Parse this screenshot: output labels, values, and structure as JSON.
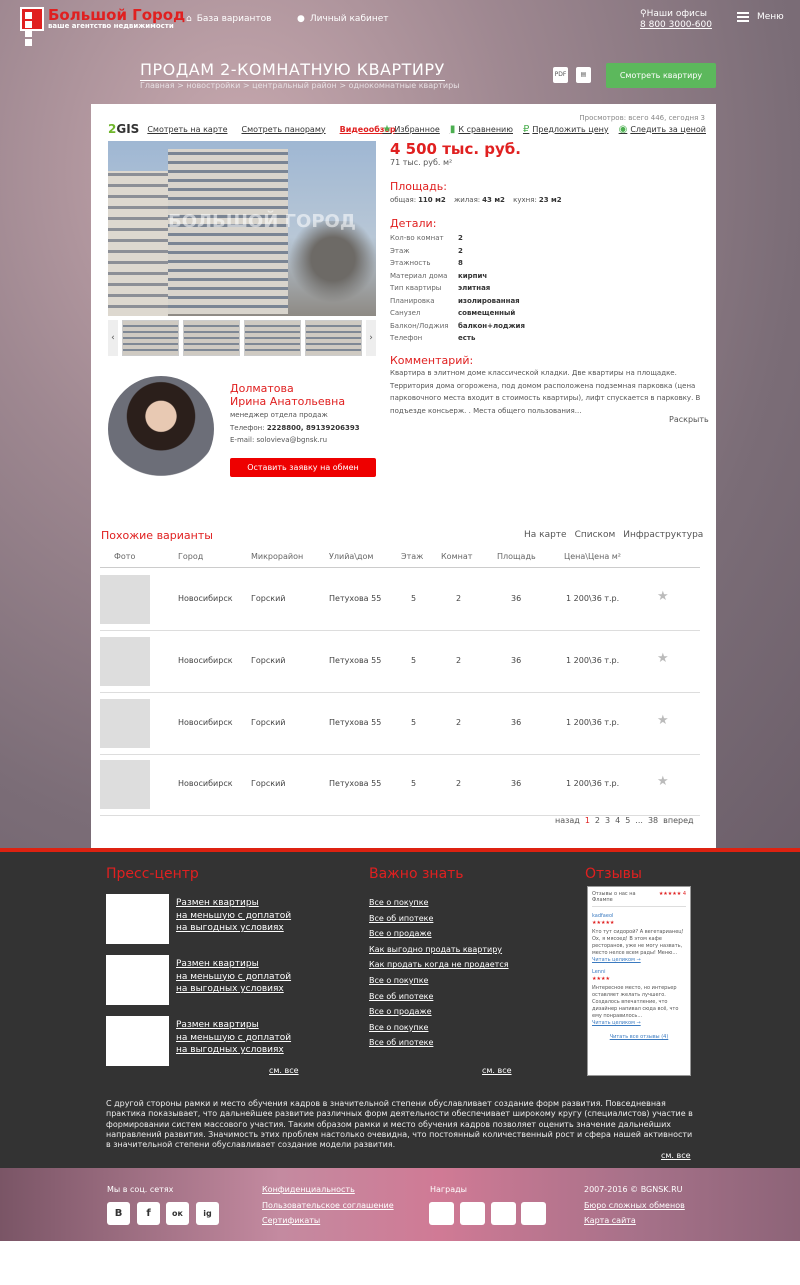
{
  "header": {
    "logo_title": "Большой Город",
    "logo_sub": "ваше агентство недвижимости",
    "nav_base": "База вариантов",
    "nav_cabinet": "Личный кабинет",
    "offices": "Наши офисы",
    "phone": "8 800 3000-600",
    "menu": "Меню"
  },
  "page": {
    "title": "ПРОДАМ 2-КОМНАТНУЮ КВАРТИРУ",
    "breadcrumb": "Главная > новостройки > центральный район > однокомнатные квартиры",
    "view_apartment": "Смотреть квартиру"
  },
  "listing": {
    "views": "Просмотров: всего 446, сегодня 3",
    "gis": "2GIS",
    "on_map": "Смотреть на карте",
    "panorama": "Смотреть панораму",
    "video": "Видеообзор",
    "favorites": "Избранное",
    "compare": "К сравнению",
    "offer_price": "Предложить цену",
    "watch_price": "Следить за ценой",
    "watermark": "БОЛЬШОЙ ГОРОД",
    "price": "4 500 тыс. руб.",
    "price_per_m": "71 тыс. руб. м²",
    "area_title": "Площадь:",
    "area_total_label": "общая:",
    "area_total": "110 м2",
    "area_living_label": "жилая:",
    "area_living": "43 м2",
    "area_kitchen_label": "кухня:",
    "area_kitchen": "23 м2",
    "details_title": "Детали:",
    "details": [
      {
        "k": "Кол-во комнат",
        "v": "2"
      },
      {
        "k": "Этаж",
        "v": "2"
      },
      {
        "k": "Этажность",
        "v": "8"
      },
      {
        "k": "Материал дома",
        "v": "кирпич"
      },
      {
        "k": "Тип квартиры",
        "v": "элитная"
      },
      {
        "k": "Планировка",
        "v": "изолированная"
      },
      {
        "k": "Санузел",
        "v": "совмещенный"
      },
      {
        "k": "Балкон/Лоджия",
        "v": "балкон+лоджия"
      },
      {
        "k": "Телефон",
        "v": "есть"
      }
    ],
    "comment_title": "Комментарий:",
    "comment": "Квартира в элитном доме классической кладки. Две квартиры на площадке. Территория дома огорожена, под домом расположена подземная парковка (цена парковочного места входит в стоимость квартиры), лифт спускается в парковку. В подъезде консьерж. . Места общего пользования...",
    "expand": "Раскрыть"
  },
  "agent": {
    "name1": "Долматова",
    "name2": "Ирина Анатольевна",
    "role": "менеджер отдела продаж",
    "phone_label": "Телефон:",
    "phone": "2228800, 89139206393",
    "email": "E-mail: solovieva@bgnsk.ru",
    "button": "Оставить заявку на обмен"
  },
  "similar": {
    "title": "Похожие варианты",
    "tabs": [
      "На карте",
      "Списком",
      "Инфраструктура"
    ],
    "columns": [
      "Фото",
      "Город",
      "Микрорайон",
      "Улийа\\дом",
      "Этаж",
      "Комнат",
      "Площадь",
      "Цена\\Цена м²"
    ],
    "rows": [
      {
        "city": "Новосибирск",
        "district": "Горский",
        "street": "Петухова 55",
        "floor": "5",
        "rooms": "2",
        "area": "36",
        "price": "1 200\\36 т.р."
      },
      {
        "city": "Новосибирск",
        "district": "Горский",
        "street": "Петухова 55",
        "floor": "5",
        "rooms": "2",
        "area": "36",
        "price": "1 200\\36 т.р."
      },
      {
        "city": "Новосибирск",
        "district": "Горский",
        "street": "Петухова 55",
        "floor": "5",
        "rooms": "2",
        "area": "36",
        "price": "1 200\\36 т.р."
      },
      {
        "city": "Новосибирск",
        "district": "Горский",
        "street": "Петухова 55",
        "floor": "5",
        "rooms": "2",
        "area": "36",
        "price": "1 200\\36 т.р."
      }
    ],
    "pager": {
      "back": "назад",
      "pages": [
        "1",
        "2",
        "3",
        "4",
        "5",
        "...",
        "38"
      ],
      "next": "вперед"
    }
  },
  "footer": {
    "press_title": "Пресс-центр",
    "news": [
      {
        "l1": "Размен квартиры",
        "l2": "на меньшую с доплатой",
        "l3": "на выгодных условиях"
      },
      {
        "l1": "Размен квартиры",
        "l2": "на меньшую с доплатой",
        "l3": "на выгодных условиях"
      },
      {
        "l1": "Размен квартиры",
        "l2": "на меньшую с доплатой",
        "l3": "на выгодных условиях"
      }
    ],
    "see_all": "см. все",
    "know_title": "Важно знать",
    "know": [
      "Все о покупке",
      "Все об ипотеке",
      "Все о продаже",
      "Как выгодно продать квартиру",
      "Как продать когда не продается",
      "Все о покупке",
      "Все об ипотеке",
      "Все о продаже",
      "Все о покупке",
      "Все об ипотеке"
    ],
    "reviews_title": "Отзывы",
    "reviews_widget_head": "Отзывы о нас на Флампе",
    "reviews_score": "★★★★★ 4",
    "review1_user": "kadfaeol",
    "review1_text": "Кто тут сидорой? А вегетарианец! Ох, я мясоед! В этом кафе ресторанов, уже не могу назвать, место нелсе всем рады! Меню...",
    "review1_more": "Читать целиком →",
    "review2_user": "Lenni",
    "review2_text": "Интересное место, но интерьер оставляет желать лучшего. Создалось впечатление, что дизайнер напивал сюда всё, что ему понравилось...",
    "review2_more": "Читать целиком →",
    "reviews_all": "Читать все отзывы (4)",
    "press_text": "С другой стороны рамки и место обучения кадров в значительной степени обуславливает создание форм развития. Повседневная практика показывает, что дальнейшее развитие различных форм деятельности обеспечивает широкому кругу (специалистов) участие в формировании систем массового участия. Таким образом рамки и место обучения кадров позволяет оценить значение дальнейших направлений развития. Значимость этих проблем настолько очевидна, что постоянный количественный рост и сфера нашей активности в значительной степени обуславливает создание модели развития.",
    "social_title": "Мы в соц. сетях",
    "social": [
      "В",
      "f",
      "ок",
      "ig"
    ],
    "links": [
      "Конфиденциальность",
      "Пользовательское соглашение",
      "Сертификаты"
    ],
    "awards_title": "Награды",
    "copyright": "2007-2016 © BGNSK.RU",
    "exchange": "Бюро сложных обменов",
    "sitemap": "Карта сайта"
  },
  "colors": {
    "accent": "#e02020",
    "green": "#5cb85c",
    "footer": "#333333"
  }
}
